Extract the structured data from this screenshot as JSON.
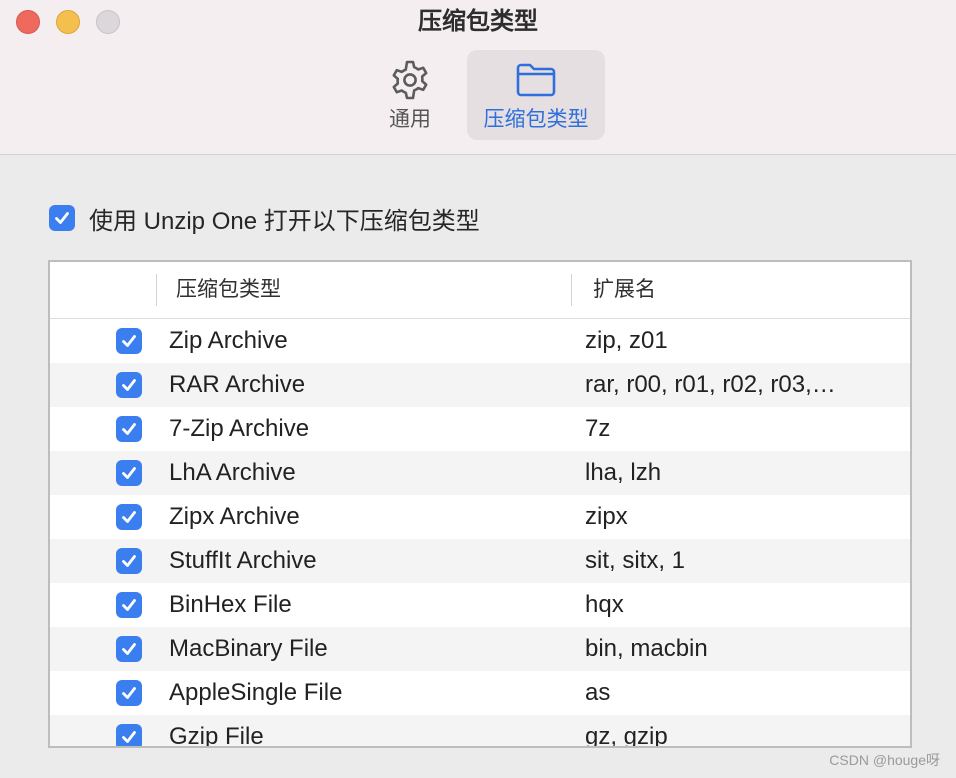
{
  "window": {
    "title": "压缩包类型"
  },
  "toolbar": {
    "tabs": [
      {
        "label": "通用",
        "icon": "gear-icon",
        "selected": false
      },
      {
        "label": "压缩包类型",
        "icon": "folder-icon",
        "selected": true
      }
    ]
  },
  "main": {
    "enable_label": "使用 Unzip One 打开以下压缩包类型",
    "enable_checked": true
  },
  "table": {
    "headers": {
      "type": "压缩包类型",
      "ext": "扩展名"
    },
    "rows": [
      {
        "name": "Zip Archive",
        "ext": "zip, z01",
        "checked": true
      },
      {
        "name": "RAR Archive",
        "ext": "rar, r00, r01, r02, r03,…",
        "checked": true
      },
      {
        "name": "7-Zip Archive",
        "ext": "7z",
        "checked": true
      },
      {
        "name": "LhA Archive",
        "ext": "lha, lzh",
        "checked": true
      },
      {
        "name": "Zipx Archive",
        "ext": "zipx",
        "checked": true
      },
      {
        "name": "StuffIt Archive",
        "ext": "sit, sitx, 1",
        "checked": true
      },
      {
        "name": "BinHex File",
        "ext": "hqx",
        "checked": true
      },
      {
        "name": "MacBinary File",
        "ext": "bin, macbin",
        "checked": true
      },
      {
        "name": "AppleSingle File",
        "ext": "as",
        "checked": true
      },
      {
        "name": "Gzip File",
        "ext": "gz, gzip",
        "checked": true
      }
    ]
  },
  "watermark": "CSDN @houge呀",
  "colors": {
    "accent": "#3a7ef0",
    "selected_tab_text": "#2f6fdb",
    "close": "#ee6a5f",
    "minimize": "#f5bf4f",
    "maximize_disabled": "#dcd7da"
  }
}
